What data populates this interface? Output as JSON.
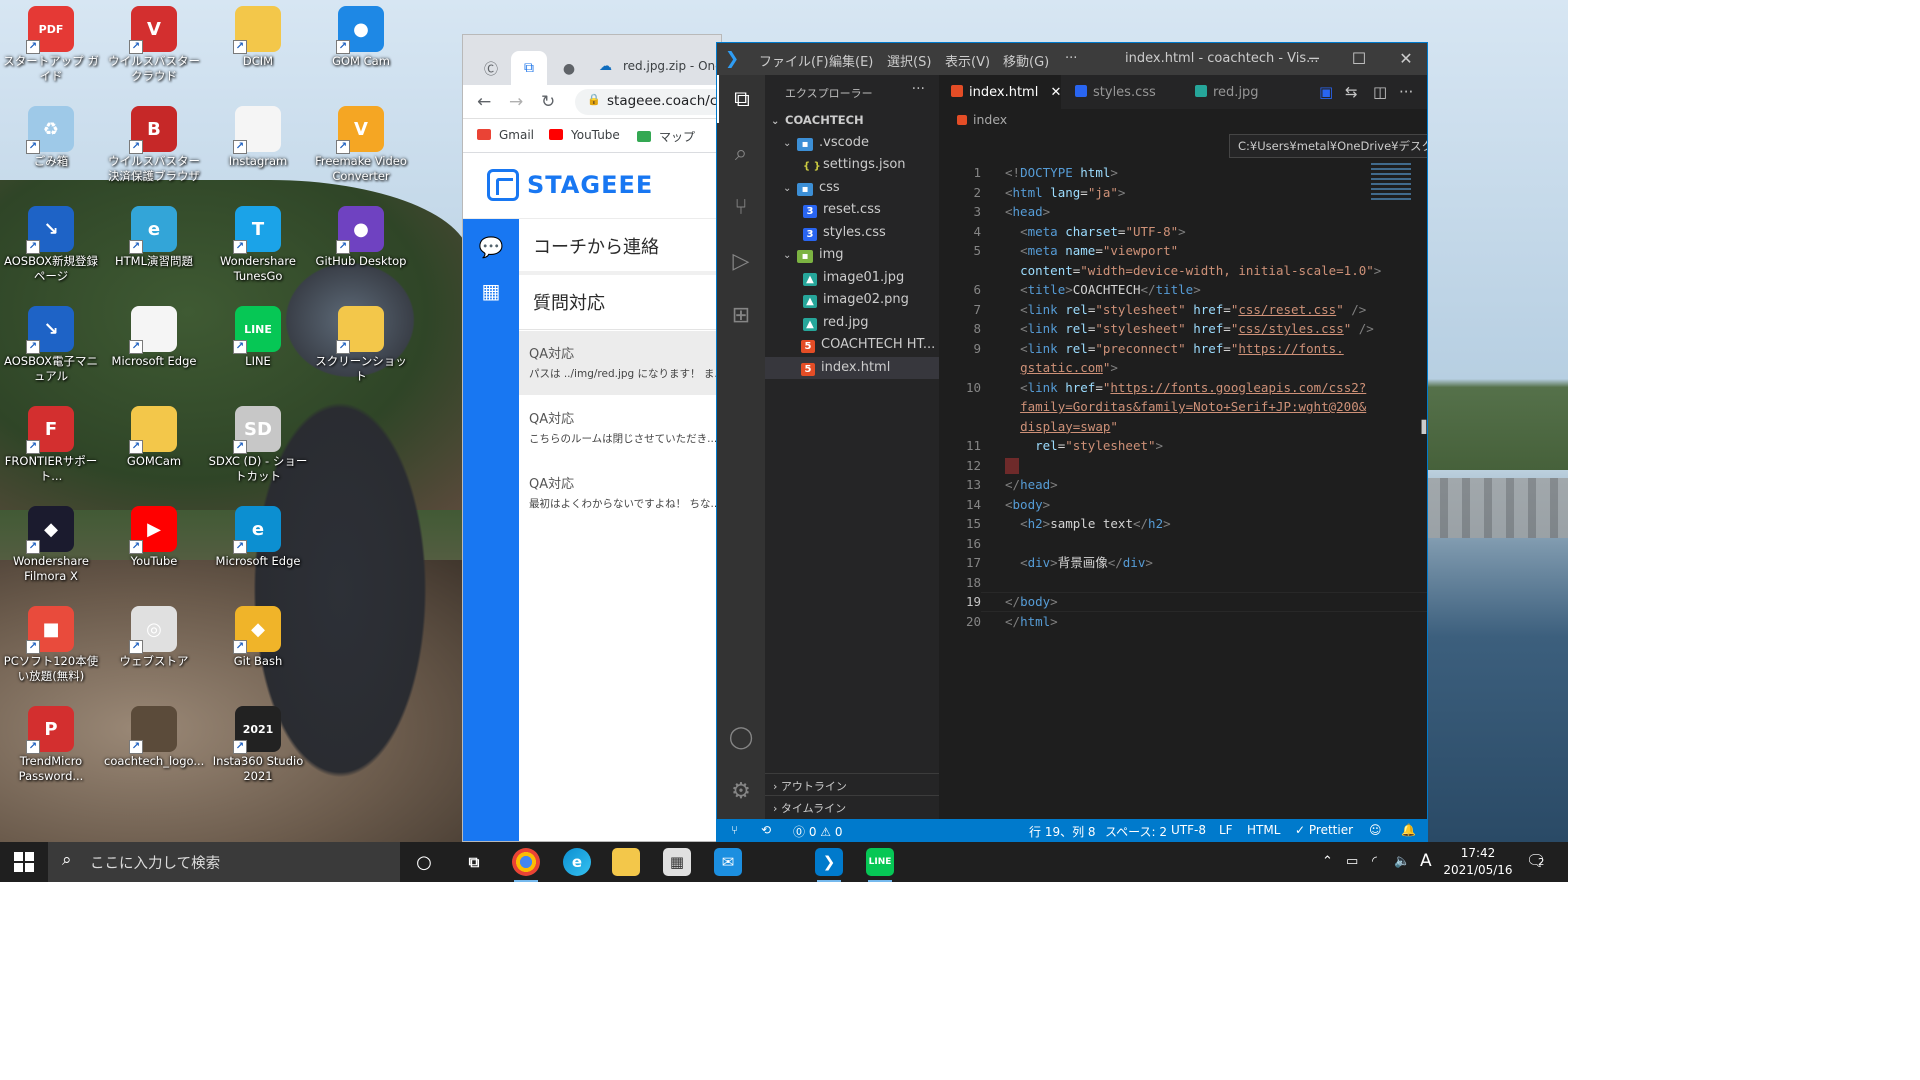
{
  "desktop": {
    "icons": [
      {
        "label": "スタートアップ ガイド",
        "icon": "pdf-icon",
        "color": "#e53935",
        "glyph": "PDF"
      },
      {
        "label": "ウイルスバスター クラウド",
        "icon": "virusbuster-icon",
        "color": "#d32f2f",
        "glyph": "V"
      },
      {
        "label": "DCIM",
        "icon": "folder-icon",
        "color": "#f3c74a",
        "glyph": ""
      },
      {
        "label": "GOM Cam",
        "icon": "gomcam-icon",
        "color": "#1e88e5",
        "glyph": "●"
      },
      {
        "label": "ごみ箱",
        "icon": "recycle-bin-icon",
        "color": "#9ec9e8",
        "glyph": "♻"
      },
      {
        "label": "ウイルスバスター決済保護ブラウザ",
        "icon": "secure-browser-icon",
        "color": "#c62828",
        "glyph": "B"
      },
      {
        "label": "Instagram",
        "icon": "file-icon",
        "color": "#f5f5f5",
        "glyph": ""
      },
      {
        "label": "Freemake Video Converter",
        "icon": "freemake-icon",
        "color": "#f5a623",
        "glyph": "V"
      },
      {
        "label": "AOSBOX新規登録ページ",
        "icon": "aosbox-icon",
        "color": "#1e63c6",
        "glyph": "↘"
      },
      {
        "label": "HTML演習問題",
        "icon": "edge-file-icon",
        "color": "#33a5d8",
        "glyph": "e"
      },
      {
        "label": "Wondershare TunesGo",
        "icon": "tunesgo-icon",
        "color": "#1ba3e8",
        "glyph": "T"
      },
      {
        "label": "GitHub Desktop",
        "icon": "github-icon",
        "color": "#6f42c1",
        "glyph": "●"
      },
      {
        "label": "AOSBOX電子マニュアル",
        "icon": "aosbox-manual-icon",
        "color": "#1e63c6",
        "glyph": "↘"
      },
      {
        "label": "Microsoft Edge",
        "icon": "file-icon",
        "color": "#f5f5f5",
        "glyph": ""
      },
      {
        "label": "LINE",
        "icon": "line-icon",
        "color": "#06c755",
        "glyph": "LINE"
      },
      {
        "label": "スクリーンショット",
        "icon": "folder-icon",
        "color": "#f3c74a",
        "glyph": ""
      },
      {
        "label": "FRONTIERサポート...",
        "icon": "frontier-icon",
        "color": "#d32f2f",
        "glyph": "F"
      },
      {
        "label": "GOMCam",
        "icon": "folder-icon",
        "color": "#f3c74a",
        "glyph": ""
      },
      {
        "label": "SDXC (D) - ショートカット",
        "icon": "sdxc-icon",
        "color": "#c7c7c7",
        "glyph": "SD"
      },
      {
        "label": "",
        "icon": "empty",
        "color": "",
        "glyph": ""
      },
      {
        "label": "Wondershare Filmora X",
        "icon": "filmora-icon",
        "color": "#1b1b2e",
        "glyph": "◆"
      },
      {
        "label": "YouTube",
        "icon": "youtube-icon",
        "color": "#ff0000",
        "glyph": "▶"
      },
      {
        "label": "Microsoft Edge",
        "icon": "edge-icon",
        "color": "#0c8fd1",
        "glyph": "e"
      },
      {
        "label": "",
        "icon": "empty",
        "color": "",
        "glyph": ""
      },
      {
        "label": "PCソフト120本使い放題(無料)",
        "icon": "pcsoft-icon",
        "color": "#e94b3c",
        "glyph": "■"
      },
      {
        "label": "ウェブストア",
        "icon": "webstore-icon",
        "color": "#e0e0e0",
        "glyph": "◎"
      },
      {
        "label": "Git Bash",
        "icon": "gitbash-icon",
        "color": "#f0b429",
        "glyph": "◆"
      },
      {
        "label": "",
        "icon": "empty",
        "color": "",
        "glyph": ""
      },
      {
        "label": "TrendMicro Password...",
        "icon": "trendmicro-pw-icon",
        "color": "#d32f2f",
        "glyph": "P"
      },
      {
        "label": "coachtech_logo...",
        "icon": "logo-file-icon",
        "color": "#5b4b3a",
        "glyph": ""
      },
      {
        "label": "Insta360 Studio 2021",
        "icon": "insta360-icon",
        "color": "#222222",
        "glyph": "2021"
      }
    ]
  },
  "browser": {
    "tab_title": "red.jpg.zip - One",
    "url": "stageee.coach/ch",
    "bookmarks": [
      {
        "label": "Gmail",
        "color": "#ea4335"
      },
      {
        "label": "YouTube",
        "color": "#ff0000"
      },
      {
        "label": "マップ",
        "color": "#34a853"
      }
    ],
    "site": {
      "logo_text": "STAGEEE",
      "menu": [
        "コーチから連絡",
        "質問対応"
      ],
      "chats": [
        {
          "title": "QA対応",
          "preview": "パスは ../img/red.jpg になります！ ま..."
        },
        {
          "title": "QA対応",
          "preview": "こちらのルームは閉じさせていただき..."
        },
        {
          "title": "QA対応",
          "preview": "最初はよくわからないですよね！ ちな..."
        }
      ]
    }
  },
  "vscode": {
    "menus": [
      "ファイル(F)",
      "編集(E)",
      "選択(S)",
      "表示(V)",
      "移動(G)",
      "···"
    ],
    "window_title": "index.html - coachtech - Vis...",
    "explorer": {
      "title": "エクスプローラー",
      "root": "COACHTECH",
      "items": [
        {
          "label": ".vscode",
          "type": "folder",
          "depth": 1
        },
        {
          "label": "settings.json",
          "type": "json",
          "depth": 2
        },
        {
          "label": "css",
          "type": "folder",
          "depth": 1
        },
        {
          "label": "reset.css",
          "type": "css",
          "depth": 2
        },
        {
          "label": "styles.css",
          "type": "css",
          "depth": 2
        },
        {
          "label": "img",
          "type": "folder-g",
          "depth": 1
        },
        {
          "label": "image01.jpg",
          "type": "img",
          "depth": 2
        },
        {
          "label": "image02.png",
          "type": "img",
          "depth": 2
        },
        {
          "label": "red.jpg",
          "type": "img",
          "depth": 2
        },
        {
          "label": "COACHTECH HT...",
          "type": "html",
          "depth": 1
        },
        {
          "label": "index.html",
          "type": "html",
          "depth": 1,
          "selected": true
        }
      ],
      "outline": "アウトライン",
      "timeline": "タイムライン"
    },
    "tabs": [
      {
        "label": "index.html",
        "active": true
      },
      {
        "label": "styles.css",
        "active": false
      },
      {
        "label": "red.jpg",
        "active": false
      }
    ],
    "breadcrumb": "index",
    "tooltip": "C:¥Users¥metal¥OneDrive¥デスクトップ¥coachtech¥index.html",
    "current_line": 19,
    "code": [
      {
        "n": "1",
        "parts": [
          [
            "p",
            "<!"
          ],
          [
            "t",
            "DOCTYPE"
          ],
          [
            "x",
            " "
          ],
          [
            "a",
            "html"
          ],
          [
            "p",
            ">"
          ]
        ]
      },
      {
        "n": "2",
        "parts": [
          [
            "p",
            "<"
          ],
          [
            "t",
            "html"
          ],
          [
            "x",
            " "
          ],
          [
            "a",
            "lang"
          ],
          [
            "x",
            "="
          ],
          [
            "s",
            "\"ja\""
          ],
          [
            "p",
            ">"
          ]
        ]
      },
      {
        "n": "3",
        "parts": [
          [
            "p",
            "<"
          ],
          [
            "t",
            "head"
          ],
          [
            "p",
            ">"
          ]
        ]
      },
      {
        "n": "4",
        "parts": [
          [
            "x",
            "  "
          ],
          [
            "p",
            "<"
          ],
          [
            "t",
            "meta"
          ],
          [
            "x",
            " "
          ],
          [
            "a",
            "charset"
          ],
          [
            "x",
            "="
          ],
          [
            "s",
            "\"UTF-8\""
          ],
          [
            "p",
            ">"
          ]
        ]
      },
      {
        "n": "5",
        "parts": [
          [
            "x",
            "  "
          ],
          [
            "p",
            "<"
          ],
          [
            "t",
            "meta"
          ],
          [
            "x",
            " "
          ],
          [
            "a",
            "name"
          ],
          [
            "x",
            "="
          ],
          [
            "s",
            "\"viewport\""
          ]
        ]
      },
      {
        "n": "",
        "parts": [
          [
            "x",
            "  "
          ],
          [
            "a",
            "content"
          ],
          [
            "x",
            "="
          ],
          [
            "s",
            "\"width=device-width, initial-scale=1.0\""
          ],
          [
            "p",
            ">"
          ]
        ]
      },
      {
        "n": "6",
        "parts": [
          [
            "x",
            "  "
          ],
          [
            "p",
            "<"
          ],
          [
            "t",
            "title"
          ],
          [
            "p",
            ">"
          ],
          [
            "x",
            "COACHTECH"
          ],
          [
            "p",
            "</"
          ],
          [
            "t",
            "title"
          ],
          [
            "p",
            ">"
          ]
        ]
      },
      {
        "n": "7",
        "parts": [
          [
            "x",
            "  "
          ],
          [
            "p",
            "<"
          ],
          [
            "t",
            "link"
          ],
          [
            "x",
            " "
          ],
          [
            "a",
            "rel"
          ],
          [
            "x",
            "="
          ],
          [
            "s",
            "\"stylesheet\""
          ],
          [
            "x",
            " "
          ],
          [
            "a",
            "href"
          ],
          [
            "x",
            "="
          ],
          [
            "s",
            "\""
          ],
          [
            "u",
            "css/reset.css"
          ],
          [
            "s",
            "\""
          ],
          [
            "x",
            " "
          ],
          [
            "p",
            "/>"
          ]
        ]
      },
      {
        "n": "8",
        "parts": [
          [
            "x",
            "  "
          ],
          [
            "p",
            "<"
          ],
          [
            "t",
            "link"
          ],
          [
            "x",
            " "
          ],
          [
            "a",
            "rel"
          ],
          [
            "x",
            "="
          ],
          [
            "s",
            "\"stylesheet\""
          ],
          [
            "x",
            " "
          ],
          [
            "a",
            "href"
          ],
          [
            "x",
            "="
          ],
          [
            "s",
            "\""
          ],
          [
            "u",
            "css/styles.css"
          ],
          [
            "s",
            "\""
          ],
          [
            "x",
            " "
          ],
          [
            "p",
            "/>"
          ]
        ]
      },
      {
        "n": "9",
        "parts": [
          [
            "x",
            "  "
          ],
          [
            "p",
            "<"
          ],
          [
            "t",
            "link"
          ],
          [
            "x",
            " "
          ],
          [
            "a",
            "rel"
          ],
          [
            "x",
            "="
          ],
          [
            "s",
            "\"preconnect\""
          ],
          [
            "x",
            " "
          ],
          [
            "a",
            "href"
          ],
          [
            "x",
            "="
          ],
          [
            "s",
            "\""
          ],
          [
            "u",
            "https://fonts."
          ]
        ]
      },
      {
        "n": "",
        "parts": [
          [
            "x",
            "  "
          ],
          [
            "u",
            "gstatic.com"
          ],
          [
            "s",
            "\""
          ],
          [
            "p",
            ">"
          ]
        ]
      },
      {
        "n": "10",
        "parts": [
          [
            "x",
            "  "
          ],
          [
            "p",
            "<"
          ],
          [
            "t",
            "link"
          ],
          [
            "x",
            " "
          ],
          [
            "a",
            "href"
          ],
          [
            "x",
            "="
          ],
          [
            "s",
            "\""
          ],
          [
            "u",
            "https://fonts.googleapis.com/css2?"
          ]
        ]
      },
      {
        "n": "",
        "parts": [
          [
            "x",
            "  "
          ],
          [
            "u",
            "family=Gorditas&family=Noto+Serif+JP:wght@200&"
          ]
        ]
      },
      {
        "n": "",
        "parts": [
          [
            "x",
            "  "
          ],
          [
            "u",
            "display=swap"
          ],
          [
            "s",
            "\""
          ]
        ]
      },
      {
        "n": "11",
        "parts": [
          [
            "x",
            "    "
          ],
          [
            "a",
            "rel"
          ],
          [
            "x",
            "="
          ],
          [
            "s",
            "\"stylesheet\""
          ],
          [
            "p",
            ">"
          ]
        ]
      },
      {
        "n": "12",
        "parts": [
          [
            "e",
            ""
          ]
        ]
      },
      {
        "n": "13",
        "parts": [
          [
            "p",
            "</"
          ],
          [
            "t",
            "head"
          ],
          [
            "p",
            ">"
          ]
        ]
      },
      {
        "n": "14",
        "parts": [
          [
            "p",
            "<"
          ],
          [
            "t",
            "body"
          ],
          [
            "p",
            ">"
          ]
        ]
      },
      {
        "n": "15",
        "parts": [
          [
            "x",
            "  "
          ],
          [
            "p",
            "<"
          ],
          [
            "t",
            "h2"
          ],
          [
            "p",
            ">"
          ],
          [
            "x",
            "sample text"
          ],
          [
            "p",
            "</"
          ],
          [
            "t",
            "h2"
          ],
          [
            "p",
            ">"
          ]
        ]
      },
      {
        "n": "16",
        "parts": []
      },
      {
        "n": "17",
        "parts": [
          [
            "x",
            "  "
          ],
          [
            "p",
            "<"
          ],
          [
            "t",
            "div"
          ],
          [
            "p",
            ">"
          ],
          [
            "x",
            "背景画像"
          ],
          [
            "p",
            "</"
          ],
          [
            "t",
            "div"
          ],
          [
            "p",
            ">"
          ]
        ]
      },
      {
        "n": "18",
        "parts": []
      },
      {
        "n": "19",
        "parts": [
          [
            "p",
            "</"
          ],
          [
            "t",
            "body"
          ],
          [
            "p",
            ">"
          ]
        ]
      },
      {
        "n": "20",
        "parts": [
          [
            "p",
            "</"
          ],
          [
            "t",
            "html"
          ],
          [
            "p",
            ">"
          ]
        ]
      }
    ],
    "status": {
      "errors": "⓪ 0 ⚠ 0",
      "position": "行 19、列 8",
      "spaces": "スペース: 2",
      "encoding": "UTF-8",
      "eol": "LF",
      "language": "HTML",
      "formatter": "✓ Prettier"
    }
  },
  "taskbar": {
    "search_placeholder": "ここに入力して検索",
    "ime": "A",
    "time": "17:42",
    "date": "2021/05/16",
    "notifications": "2"
  }
}
